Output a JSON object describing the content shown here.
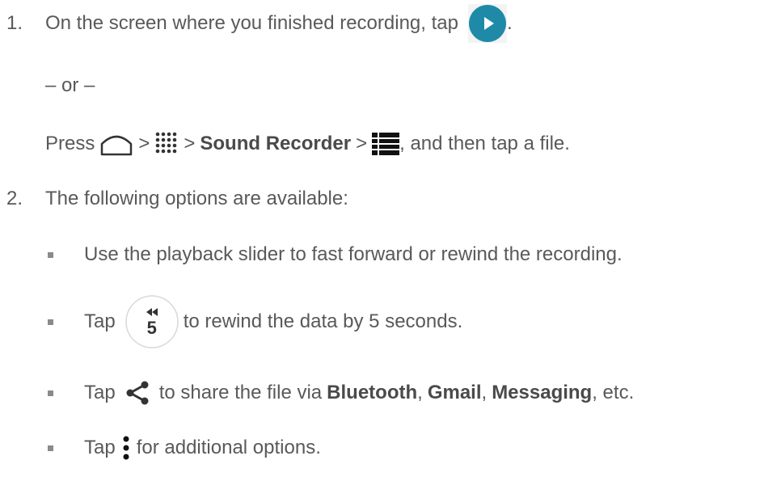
{
  "step1": {
    "number": "1.",
    "text_before": "On the screen where you finished recording, tap",
    "text_after": ".",
    "play_icon": "play-icon",
    "play_color": "#1f8aa8"
  },
  "or_text": "– or –",
  "press_line": {
    "press": "Press",
    "sep1": ">",
    "sep2": ">",
    "sound_recorder": "Sound Recorder",
    "sep3": ">",
    "after": ", and then tap a file.",
    "icons": [
      "home-icon",
      "apps-grid-icon",
      "list-icon"
    ]
  },
  "step2": {
    "number": "2.",
    "text": "The following options are available:"
  },
  "bullets": {
    "slider": "Use the playback slider to fast forward or rewind the recording.",
    "rewind_tap": "Tap",
    "rewind_icon_digit": "5",
    "rewind_text": "to rewind the data by 5 seconds.",
    "share_tap": "Tap",
    "share_text": "to share the file via",
    "bluetooth": "Bluetooth",
    "comma1": ",",
    "gmail": "Gmail",
    "comma2": ",",
    "messaging": "Messaging",
    "etc": ", etc.",
    "more_tap": "Tap",
    "more_text": "for additional options."
  }
}
